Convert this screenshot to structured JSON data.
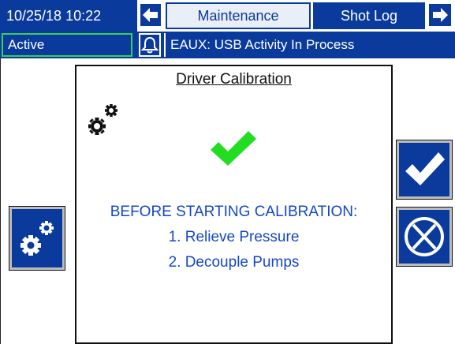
{
  "header": {
    "datetime": "10/25/18 10:22",
    "tabs": [
      {
        "label": "Maintenance",
        "active": true
      },
      {
        "label": "Shot Log",
        "active": false
      }
    ]
  },
  "status": {
    "state": "Active",
    "message": "EAUX: USB Activity In Process"
  },
  "dialog": {
    "title": "Driver Calibration",
    "instructions": [
      "BEFORE STARTING CALIBRATION:",
      "1. Relieve Pressure",
      "2. Decouple Pumps"
    ]
  },
  "colors": {
    "navy": "#0a3b9c",
    "status_green": "#36d05a",
    "check_green": "#22dd22",
    "instruction_blue": "#1447c8"
  },
  "icons": {
    "nav_left": "arrow-left-icon",
    "nav_right": "arrow-right-icon",
    "alarm": "bell-icon",
    "gears": "gears-icon",
    "ok": "checkmark-icon",
    "cancel": "cancel-x-icon"
  }
}
